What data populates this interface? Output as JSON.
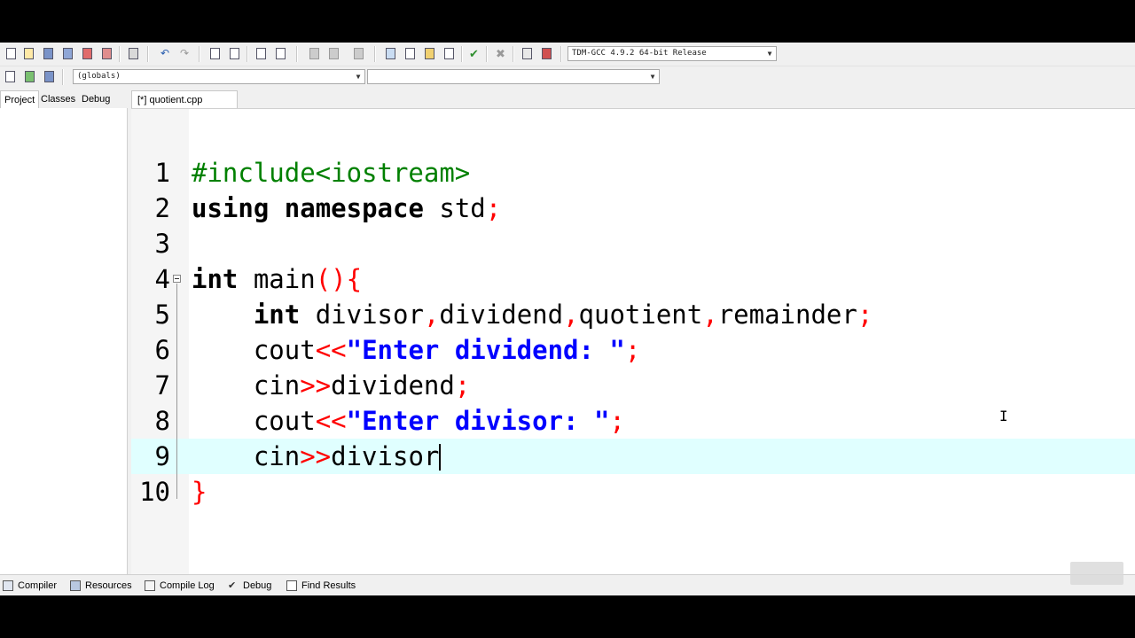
{
  "toolbar": {
    "compiler_select": "TDM-GCC 4.9.2 64-bit Release",
    "scope_select": "(globals)",
    "function_select": ""
  },
  "left_panel": {
    "tabs": [
      "Project",
      "Classes",
      "Debug"
    ]
  },
  "editor": {
    "file_tab": "[*] quotient.cpp",
    "lines": [
      {
        "num": "1",
        "tokens": [
          [
            "pp",
            "#include<iostream>"
          ]
        ]
      },
      {
        "num": "2",
        "tokens": [
          [
            "kw",
            "using"
          ],
          [
            "id",
            " "
          ],
          [
            "kw",
            "namespace"
          ],
          [
            "id",
            " std"
          ],
          [
            "sym",
            ";"
          ]
        ]
      },
      {
        "num": "3",
        "tokens": []
      },
      {
        "num": "4",
        "tokens": [
          [
            "kw",
            "int"
          ],
          [
            "id",
            " main"
          ],
          [
            "sym",
            "(){"
          ]
        ]
      },
      {
        "num": "5",
        "tokens": [
          [
            "id",
            "    "
          ],
          [
            "kw",
            "int"
          ],
          [
            "id",
            " divisor"
          ],
          [
            "sym",
            ","
          ],
          [
            "id",
            "dividend"
          ],
          [
            "sym",
            ","
          ],
          [
            "id",
            "quotient"
          ],
          [
            "sym",
            ","
          ],
          [
            "id",
            "remainder"
          ],
          [
            "sym",
            ";"
          ]
        ]
      },
      {
        "num": "6",
        "tokens": [
          [
            "id",
            "    cout"
          ],
          [
            "sym",
            "<<"
          ],
          [
            "str",
            "\"Enter dividend: \""
          ],
          [
            "sym",
            ";"
          ]
        ]
      },
      {
        "num": "7",
        "tokens": [
          [
            "id",
            "    cin"
          ],
          [
            "sym",
            ">>"
          ],
          [
            "id",
            "dividend"
          ],
          [
            "sym",
            ";"
          ]
        ]
      },
      {
        "num": "8",
        "tokens": [
          [
            "id",
            "    cout"
          ],
          [
            "sym",
            "<<"
          ],
          [
            "str",
            "\"Enter divisor: \""
          ],
          [
            "sym",
            ";"
          ]
        ]
      },
      {
        "num": "9",
        "tokens": [
          [
            "id",
            "    cin"
          ],
          [
            "sym",
            ">>"
          ],
          [
            "id",
            "divisor"
          ]
        ]
      },
      {
        "num": "10",
        "tokens": [
          [
            "sym",
            "}"
          ]
        ]
      }
    ],
    "active_line": 9
  },
  "bottom_tabs": [
    "Compiler",
    "Resources",
    "Compile Log",
    "Debug",
    "Find Results"
  ],
  "colors": {
    "preprocessor": "#008000",
    "string": "#0000ff",
    "symbol": "#ff0000",
    "active_line": "#e0ffff"
  }
}
